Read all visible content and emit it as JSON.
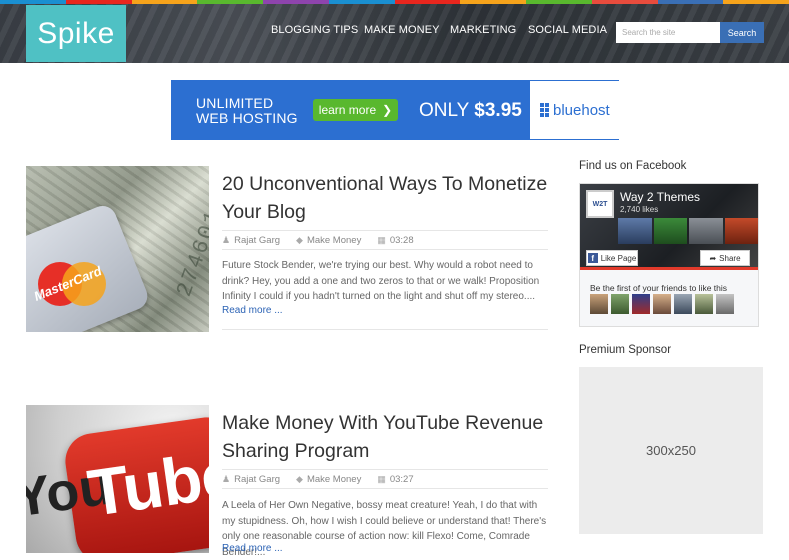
{
  "header": {
    "logo": "Spike",
    "nav": [
      "BLOGGING TIPS",
      "MAKE MONEY",
      "MARKETING",
      "SOCIAL MEDIA"
    ],
    "search_placeholder": "Search the site",
    "search_button": "Search",
    "rainbow_colors": [
      "#1a8fd1",
      "#e8261e",
      "#f6a31b",
      "#59b82e",
      "#8e44ad",
      "#1a8fd1",
      "#e8261e",
      "#f6a31b",
      "#59b82e",
      "#e84c3d",
      "#3a6fb5",
      "#f6a31b"
    ]
  },
  "banner": {
    "line1": "UNLIMITED",
    "line2": "WEB HOSTING",
    "button": "learn more",
    "only": "ONLY",
    "price": "$3.95",
    "brand": "bluehost"
  },
  "posts": [
    {
      "title": "20 Unconventional Ways To Monetize Your Blog",
      "author": "Rajat Garg",
      "category": "Make Money",
      "time": "03:28",
      "excerpt": "Future Stock Bender, we're trying our best. Why would a robot need to drink? Hey, you add a one and two zeros to that or we walk! Proposition Infinity I could if you hadn't turned on the light and shut off my stereo....",
      "read_more": "Read more ...",
      "image_text": "MasterCard",
      "image_numbers": "274601"
    },
    {
      "title": "Make Money With YouTube Revenue Sharing Program",
      "author": "Rajat Garg",
      "category": "Make Money",
      "time": "03:27",
      "excerpt": "A Leela of Her Own Negative, bossy meat creature! Yeah, I do that with my stupidness. Oh, how I wish I could believe or understand that! There's only one reasonable course of action now: kill Flexo! Come, Comrade Bender!...",
      "read_more": "Read more ...",
      "image_you": "You",
      "image_tube": "Tube"
    }
  ],
  "sidebar": {
    "facebook_heading": "Find us on Facebook",
    "fb_page_name": "Way 2 Themes",
    "fb_logo": "W2T",
    "fb_likes": "2,740 likes",
    "fb_like_button": "Like Page",
    "fb_share_button": "Share",
    "fb_friends_text": "Be the first of your friends to like this",
    "sponsor_heading": "Premium Sponsor",
    "sponsor_box": "300x250"
  }
}
